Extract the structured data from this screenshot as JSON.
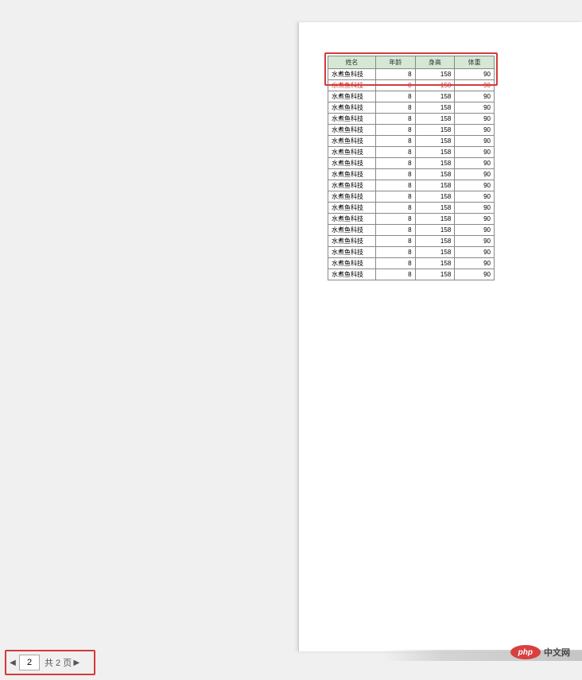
{
  "table": {
    "headers": [
      "姓名",
      "年龄",
      "身高",
      "体重"
    ],
    "rows": [
      {
        "name": "水煮鱼科技",
        "age": "8",
        "height": "158",
        "weight": "90",
        "red": false
      },
      {
        "name": "水煮鱼科技",
        "age": "8",
        "height": "158",
        "weight": "90",
        "red": true
      },
      {
        "name": "水煮鱼科技",
        "age": "8",
        "height": "158",
        "weight": "90",
        "red": false
      },
      {
        "name": "水煮鱼科技",
        "age": "8",
        "height": "158",
        "weight": "90",
        "red": false
      },
      {
        "name": "水煮鱼科技",
        "age": "8",
        "height": "158",
        "weight": "90",
        "red": false
      },
      {
        "name": "水煮鱼科技",
        "age": "8",
        "height": "158",
        "weight": "90",
        "red": false
      },
      {
        "name": "水煮鱼科技",
        "age": "8",
        "height": "158",
        "weight": "90",
        "red": false
      },
      {
        "name": "水煮鱼科技",
        "age": "8",
        "height": "158",
        "weight": "90",
        "red": false
      },
      {
        "name": "水煮鱼科技",
        "age": "8",
        "height": "158",
        "weight": "90",
        "red": false
      },
      {
        "name": "水煮鱼科技",
        "age": "8",
        "height": "158",
        "weight": "90",
        "red": false
      },
      {
        "name": "水煮鱼科技",
        "age": "8",
        "height": "158",
        "weight": "90",
        "red": false
      },
      {
        "name": "水煮鱼科技",
        "age": "8",
        "height": "158",
        "weight": "90",
        "red": false
      },
      {
        "name": "水煮鱼科技",
        "age": "8",
        "height": "158",
        "weight": "90",
        "red": false
      },
      {
        "name": "水煮鱼科技",
        "age": "8",
        "height": "158",
        "weight": "90",
        "red": false
      },
      {
        "name": "水煮鱼科技",
        "age": "8",
        "height": "158",
        "weight": "90",
        "red": false
      },
      {
        "name": "水煮鱼科技",
        "age": "8",
        "height": "158",
        "weight": "90",
        "red": false
      },
      {
        "name": "水煮鱼科技",
        "age": "8",
        "height": "158",
        "weight": "90",
        "red": false
      },
      {
        "name": "水煮鱼科技",
        "age": "8",
        "height": "158",
        "weight": "90",
        "red": false
      },
      {
        "name": "水煮鱼科技",
        "age": "8",
        "height": "158",
        "weight": "90",
        "red": false
      }
    ]
  },
  "pagination": {
    "prev_icon": "◀",
    "next_icon": "▶",
    "current_page": "2",
    "total_label": "共 2 页"
  },
  "watermark": {
    "php_label": "php",
    "site_label": "中文网"
  }
}
